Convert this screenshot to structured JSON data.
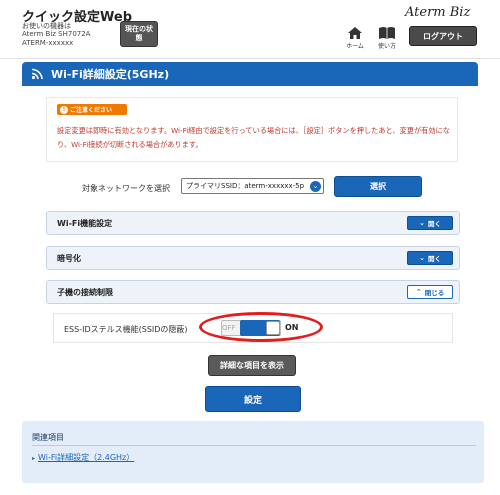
{
  "header": {
    "app_title": "クイック設定Web",
    "device_caption": "お使いの機器は",
    "device_model": "Aterm Biz SH7072A",
    "device_id": "ATERM-xxxxxx",
    "status_button": "現在の状態",
    "logo": "Aterm Biz",
    "home_label": "ホーム",
    "guide_label": "使い方",
    "logout_button": "ログアウト"
  },
  "page": {
    "title": "Wi-Fi詳細設定(5GHz)"
  },
  "notice": {
    "badge": "ご注意ください",
    "text": "設定変更は即時に有効となります。Wi-Fi経由で設定を行っている場合には、［設定］ボタンを押したあと、変更が有効になり、Wi-Fi接続が切断される場合があります。"
  },
  "network_select": {
    "label": "対象ネットワークを選択",
    "selected": "プライマリSSID：aterm-xxxxxx-5p",
    "button": "選択"
  },
  "sections": {
    "wifi_function": {
      "title": "Wi-Fi機能設定",
      "toggle": "開く"
    },
    "encryption": {
      "title": "暗号化",
      "toggle": "開く"
    },
    "client_restriction": {
      "title": "子機の接続制限",
      "toggle": "閉じる"
    }
  },
  "stealth": {
    "label": "ESS-IDステルス機能(SSIDの隠蔽)",
    "off_label": "OFF",
    "on_label": "ON",
    "state": "ON"
  },
  "buttons": {
    "show_detail": "詳細な項目を表示",
    "apply": "設定"
  },
  "related": {
    "title": "関連項目",
    "link": "Wi-Fi詳細設定（2.4GHz）"
  },
  "colors": {
    "primary": "#1a66b8",
    "notice_text": "#c0392b",
    "notice_badge": "#f07a00",
    "highlight": "#e21d1d",
    "related_bg": "#e2edf9"
  }
}
